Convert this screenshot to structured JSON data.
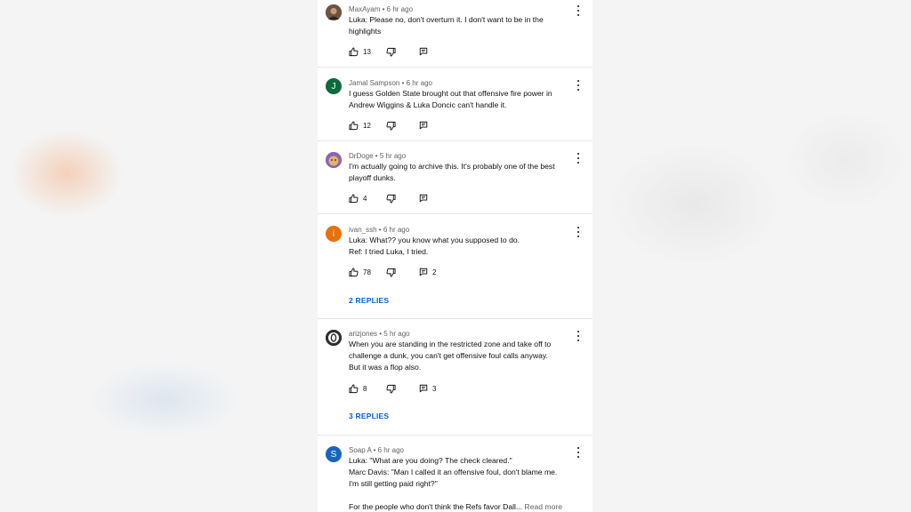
{
  "comments": [
    {
      "author": "MaxAyam",
      "time": "6 hr ago",
      "text_lines": [
        "Luka: Please no, don't overturn it. I don't want to be in the",
        "highlights"
      ],
      "likes": "13",
      "reply_count": "",
      "avatar_letter": "",
      "avatar_color": "#5a4636"
    },
    {
      "author": "Jamal Sampson",
      "time": "6 hr ago",
      "text_lines": [
        "I guess Golden State brought out that offensive fire power in",
        "Andrew Wiggins & Luka Doncic can't handle it."
      ],
      "likes": "12",
      "reply_count": "",
      "avatar_letter": "J",
      "avatar_color": "#0b6b3a"
    },
    {
      "author": "DrDoge",
      "time": "5 hr ago",
      "text_lines": [
        "I'm actually going to archive this. It's probably one of the best",
        "playoff dunks."
      ],
      "likes": "4",
      "reply_count": "",
      "avatar_letter": "",
      "avatar_color": "#c9a94a"
    },
    {
      "author": "ivan_ssh",
      "time": "6 hr ago",
      "text_lines": [
        "Luka: What?? you know what you supposed to do.",
        "Ref: I tried Luka, I tried."
      ],
      "likes": "78",
      "reply_count": "2",
      "replies_label": "2 REPLIES",
      "avatar_letter": "i",
      "avatar_color": "#e8710a"
    },
    {
      "author": "arizjones",
      "time": "5 hr ago",
      "text_lines": [
        "When you are standing in the restricted zone and take off to",
        "challenge a dunk, you can't get offensive foul calls anyway.",
        "But it was a flop also."
      ],
      "likes": "8",
      "reply_count": "3",
      "replies_label": "3 REPLIES",
      "avatar_letter": "",
      "avatar_color": "#333333"
    },
    {
      "author": "Soap A",
      "time": "6 hr ago",
      "text_lines": [
        "Luka: \"What are you doing? The check cleared.\"",
        "Marc Davis: \"Man I called it an offensive foul, don't blame me.",
        "I'm still getting paid right?\"",
        "",
        "For the people who don't think the Refs favor Dall..."
      ],
      "read_more": "Read more",
      "avatar_letter": "S",
      "avatar_color": "#1565c0"
    }
  ]
}
